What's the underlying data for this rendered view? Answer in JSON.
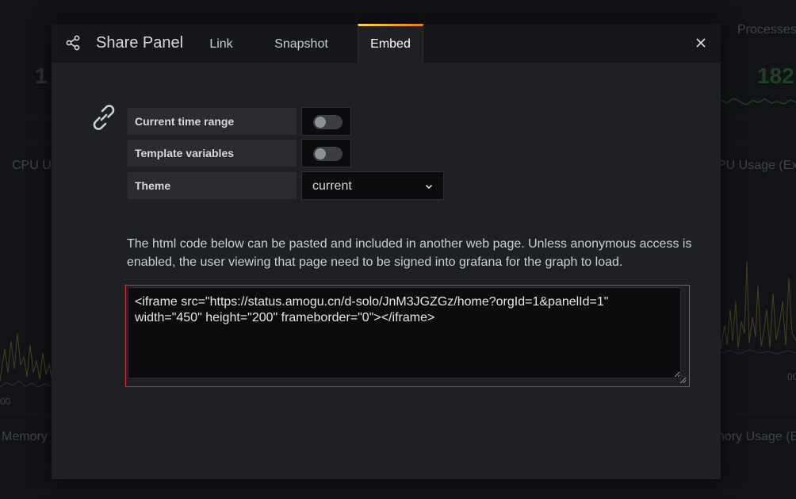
{
  "background": {
    "stat_left": "1",
    "stat_right": "182",
    "processes_label": "Processes",
    "cpu_left": "CPU Us",
    "cpu_right": "PU Usage (Exte",
    "memory_left": "Memory U",
    "memory_right": "nory Usage (Ex",
    "axis_left": "00",
    "axis_right": "00"
  },
  "modal": {
    "title": "Share Panel",
    "tabs": [
      {
        "label": "Link",
        "active": false
      },
      {
        "label": "Snapshot",
        "active": false
      },
      {
        "label": "Embed",
        "active": true
      }
    ],
    "close_icon": "close-icon",
    "header_icon": "share-icon"
  },
  "form": {
    "link_icon": "link-icon",
    "current_time_range": {
      "label": "Current time range",
      "enabled": false
    },
    "template_variables": {
      "label": "Template variables",
      "enabled": false
    },
    "theme": {
      "label": "Theme",
      "value": "current"
    }
  },
  "info_text": "The html code below can be pasted and included in another web page. Unless anonymous access is enabled, the user viewing that page need to be signed into grafana for the graph to load.",
  "embed_code": "<iframe src=\"https://status.amogu.cn/d-solo/JnM3JGZGz/home?orgId=1&panelId=1\" width=\"450\" height=\"200\" frameborder=\"0\"></iframe>",
  "colors": {
    "accent_gradient_start": "#f9d74a",
    "accent_gradient_end": "#eb7b18",
    "error_border": "#e02f44",
    "stat_green": "#2f6a36"
  }
}
